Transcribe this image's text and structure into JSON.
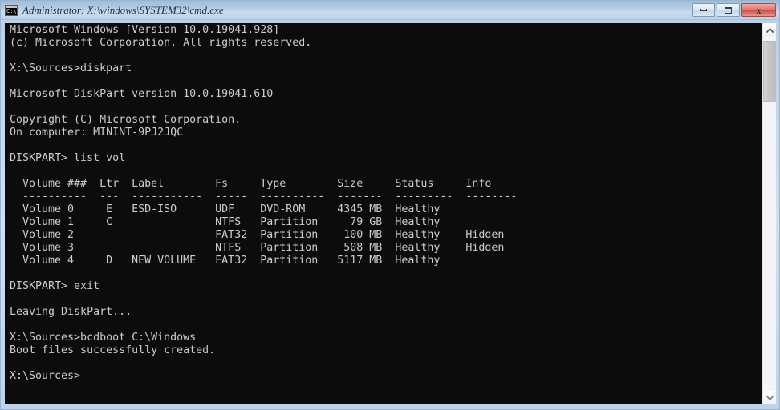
{
  "window": {
    "title": "Administrator: X:\\windows\\SYSTEM32\\cmd.exe",
    "icon_name": "cmd-icon",
    "icon_text": "C:\\_",
    "colors": {
      "titlebar_top": "#9fbcd9",
      "titlebar_bottom": "#bdd3e8",
      "frame": "#bed3e8",
      "console_bg": "#0c0c0c",
      "console_fg": "#cccccc",
      "close_button": "#ca4e46"
    }
  },
  "controls": {
    "minimize_label": "Minimize",
    "maximize_label": "Maximize",
    "close_label": "Close",
    "close_glyph": "x"
  },
  "scrollbar": {
    "up_label": "Scroll up",
    "down_label": "Scroll down",
    "thumb_label": "Scroll thumb"
  },
  "console": {
    "lines": [
      "Microsoft Windows [Version 10.0.19041.928]",
      "(c) Microsoft Corporation. All rights reserved.",
      "",
      "X:\\Sources>diskpart",
      "",
      "Microsoft DiskPart version 10.0.19041.610",
      "",
      "Copyright (C) Microsoft Corporation.",
      "On computer: MININT-9PJ2JQC",
      "",
      "DISKPART> list vol",
      "",
      "  Volume ###  Ltr  Label        Fs     Type        Size     Status     Info",
      "  ----------  ---  -----------  -----  ----------  -------  ---------  --------",
      "  Volume 0     E   ESD-ISO      UDF    DVD-ROM     4345 MB  Healthy",
      "  Volume 1     C                NTFS   Partition     79 GB  Healthy",
      "  Volume 2                      FAT32  Partition    100 MB  Healthy    Hidden",
      "  Volume 3                      NTFS   Partition    508 MB  Healthy    Hidden",
      "  Volume 4     D   NEW VOLUME   FAT32  Partition   5117 MB  Healthy",
      "",
      "DISKPART> exit",
      "",
      "Leaving DiskPart...",
      "",
      "X:\\Sources>bcdboot C:\\Windows",
      "Boot files successfully created.",
      "",
      "X:\\Sources>"
    ],
    "text": "Microsoft Windows [Version 10.0.19041.928]\n(c) Microsoft Corporation. All rights reserved.\n\nX:\\Sources>diskpart\n\nMicrosoft DiskPart version 10.0.19041.610\n\nCopyright (C) Microsoft Corporation.\nOn computer: MININT-9PJ2JQC\n\nDISKPART> list vol\n\n  Volume ###  Ltr  Label        Fs     Type        Size     Status     Info\n  ----------  ---  -----------  -----  ----------  -------  ---------  --------\n  Volume 0     E   ESD-ISO      UDF    DVD-ROM     4345 MB  Healthy\n  Volume 1     C                NTFS   Partition     79 GB  Healthy\n  Volume 2                      FAT32  Partition    100 MB  Healthy    Hidden\n  Volume 3                      NTFS   Partition    508 MB  Healthy    Hidden\n  Volume 4     D   NEW VOLUME   FAT32  Partition   5117 MB  Healthy\n\nDISKPART> exit\n\nLeaving DiskPart...\n\nX:\\Sources>bcdboot C:\\Windows\nBoot files successfully created.\n\nX:\\Sources>",
    "volume_table": {
      "headers": [
        "Volume ###",
        "Ltr",
        "Label",
        "Fs",
        "Type",
        "Size",
        "Status",
        "Info"
      ],
      "rows": [
        [
          "Volume 0",
          "E",
          "ESD-ISO",
          "UDF",
          "DVD-ROM",
          "4345 MB",
          "Healthy",
          ""
        ],
        [
          "Volume 1",
          "C",
          "",
          "NTFS",
          "Partition",
          "79 GB",
          "Healthy",
          ""
        ],
        [
          "Volume 2",
          "",
          "",
          "FAT32",
          "Partition",
          "100 MB",
          "Healthy",
          "Hidden"
        ],
        [
          "Volume 3",
          "",
          "",
          "NTFS",
          "Partition",
          "508 MB",
          "Healthy",
          "Hidden"
        ],
        [
          "Volume 4",
          "D",
          "NEW VOLUME",
          "FAT32",
          "Partition",
          "5117 MB",
          "Healthy",
          ""
        ]
      ]
    },
    "commands": [
      "diskpart",
      "list vol",
      "exit",
      "bcdboot C:\\Windows"
    ],
    "prompt": "X:\\Sources>",
    "computer_name": "MININT-9PJ2JQC",
    "windows_version": "10.0.19041.928",
    "diskpart_version": "10.0.19041.610"
  }
}
